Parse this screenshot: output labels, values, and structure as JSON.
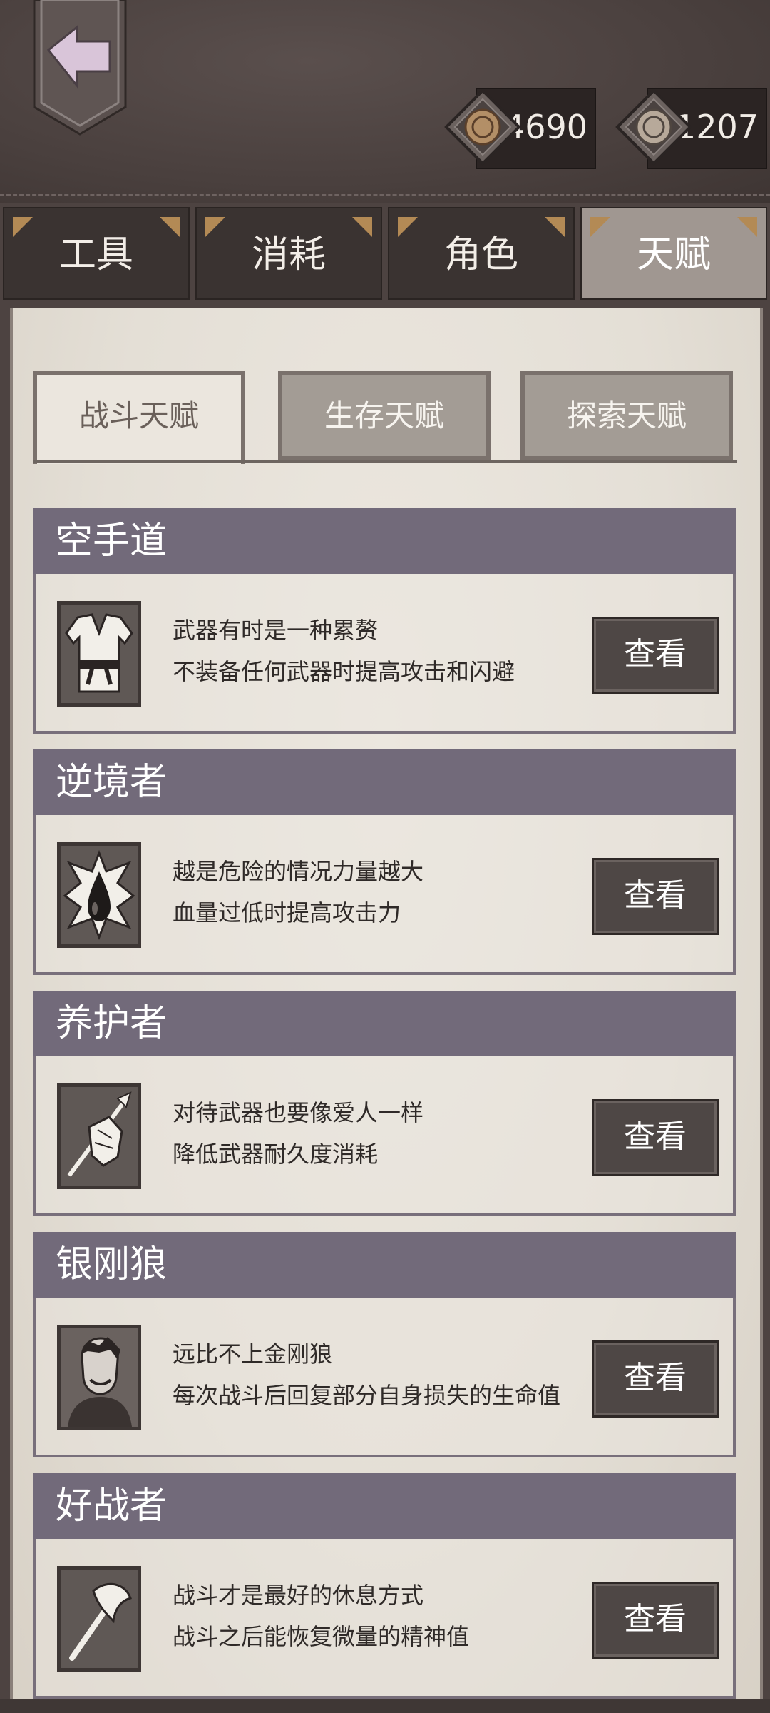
{
  "currencies": [
    {
      "name": "coin-a",
      "value": "4690"
    },
    {
      "name": "coin-b",
      "value": "1207"
    }
  ],
  "main_tabs": [
    {
      "label": "工具",
      "active": false
    },
    {
      "label": "消耗",
      "active": false
    },
    {
      "label": "角色",
      "active": false
    },
    {
      "label": "天赋",
      "active": true
    }
  ],
  "sub_tabs": [
    {
      "label": "战斗天赋",
      "active": true
    },
    {
      "label": "生存天赋",
      "active": false
    },
    {
      "label": "探索天赋",
      "active": false
    }
  ],
  "talents": [
    {
      "title": "空手道",
      "line1": "武器有时是一种累赘",
      "line2": "不装备任何武器时提高攻击和闪避",
      "button": "查看",
      "icon": "karate-gi-icon"
    },
    {
      "title": "逆境者",
      "line1": "越是危险的情况力量越大",
      "line2": "血量过低时提高攻击力",
      "button": "查看",
      "icon": "blood-drop-icon"
    },
    {
      "title": "养护者",
      "line1": "对待武器也要像爱人一样",
      "line2": "降低武器耐久度消耗",
      "button": "查看",
      "icon": "spear-cloth-icon"
    },
    {
      "title": "银刚狼",
      "line1": "远比不上金刚狼",
      "line2": "每次战斗后回复部分自身损失的生命值",
      "button": "查看",
      "icon": "wolverine-portrait-icon"
    },
    {
      "title": "好战者",
      "line1": "战斗才是最好的休息方式",
      "line2": "战斗之后能恢复微量的精神值",
      "button": "查看",
      "icon": "axe-icon"
    }
  ],
  "colors": {
    "accent": "#726a7a",
    "button": "#4e4745",
    "parchment": "#e9e4dc",
    "leather": "#4a403e"
  }
}
